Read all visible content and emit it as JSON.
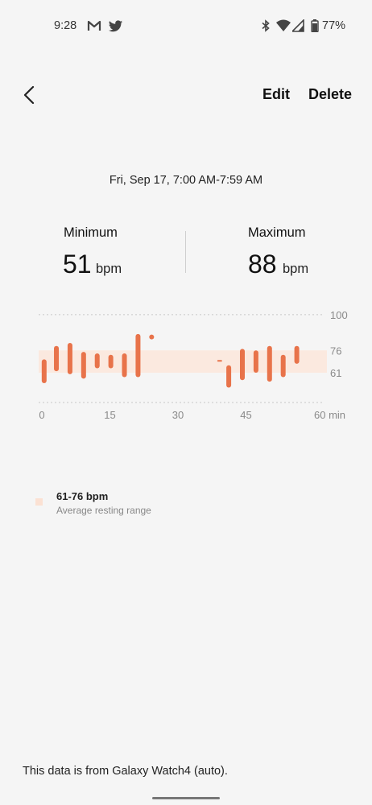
{
  "status_bar": {
    "time": "9:28",
    "battery_percent": "77%",
    "icons": [
      "gmail-icon",
      "twitter-icon",
      "bluetooth-icon",
      "wifi-icon",
      "signal-icon",
      "battery-icon"
    ]
  },
  "header": {
    "back_icon": "back-arrow-icon",
    "edit_label": "Edit",
    "delete_label": "Delete"
  },
  "date_range": "Fri, Sep 17, 7:00 AM-7:59 AM",
  "stats": {
    "minimum": {
      "label": "Minimum",
      "value": "51",
      "unit": "bpm"
    },
    "maximum": {
      "label": "Maximum",
      "value": "88",
      "unit": "bpm"
    }
  },
  "chart_data": {
    "type": "bar",
    "x_ticks": [
      "0",
      "15",
      "30",
      "45",
      "60 min"
    ],
    "y_ticks": [
      "100",
      "76",
      "61"
    ],
    "xlim": [
      0,
      60
    ],
    "ylim": [
      41,
      101
    ],
    "resting_range": [
      61,
      76
    ],
    "series": [
      {
        "ranges": [
          {
            "x": 0.5,
            "low": 54,
            "high": 70
          },
          {
            "x": 3.2,
            "low": 62,
            "high": 79
          },
          {
            "x": 6.2,
            "low": 60,
            "high": 81
          },
          {
            "x": 9.2,
            "low": 57,
            "high": 75
          },
          {
            "x": 12.2,
            "low": 64,
            "high": 74
          },
          {
            "x": 15.2,
            "low": 64,
            "high": 73
          },
          {
            "x": 18.2,
            "low": 58,
            "high": 74
          },
          {
            "x": 21.2,
            "low": 58,
            "high": 87
          },
          {
            "x": 24.2,
            "low": 84,
            "high": 86
          },
          {
            "x": 39.2,
            "low": 68.5,
            "high": 69.5
          },
          {
            "x": 41.2,
            "low": 51,
            "high": 66
          },
          {
            "x": 44.2,
            "low": 56,
            "high": 77
          },
          {
            "x": 47.2,
            "low": 61,
            "high": 76
          },
          {
            "x": 50.2,
            "low": 55,
            "high": 79
          },
          {
            "x": 53.2,
            "low": 58,
            "high": 73
          },
          {
            "x": 56.2,
            "low": 67,
            "high": 79
          }
        ]
      }
    ],
    "colors": {
      "bar": "#e8734a",
      "range_band": "#fbe9df",
      "grid": "#c8c8c8",
      "tick_text": "#8a8a8a"
    }
  },
  "legend": {
    "range_label": "61-76 bpm",
    "range_sublabel": "Average resting range"
  },
  "footer": {
    "source_note": "This data is from Galaxy Watch4 (auto)."
  }
}
